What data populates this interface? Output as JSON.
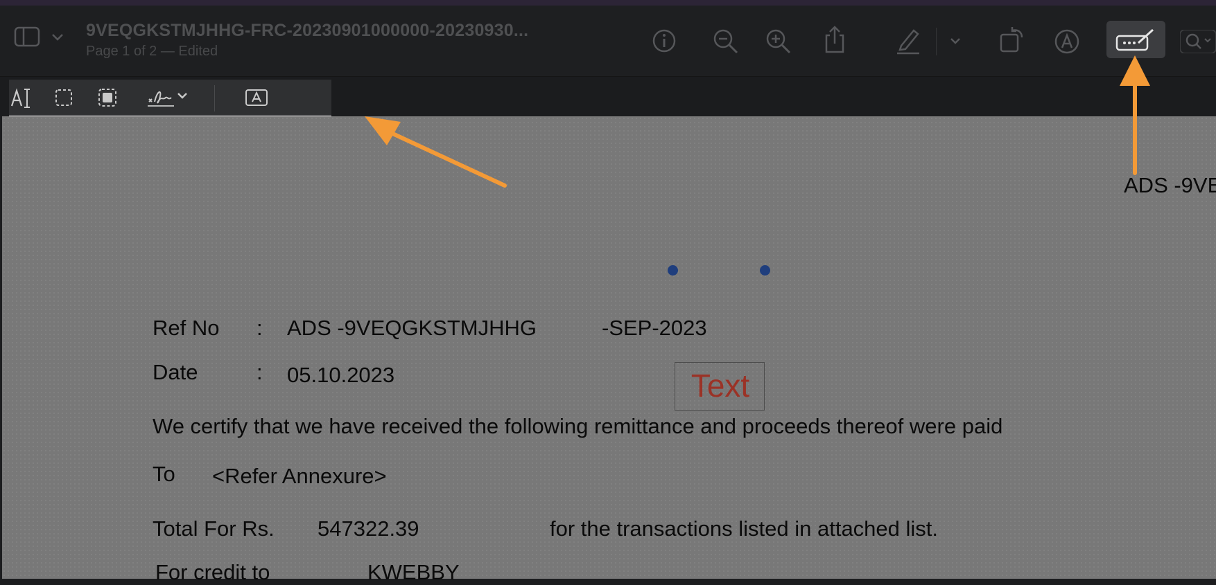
{
  "window": {
    "title": "9VEQGKSTMJHHG-FRC-20230901000000-20230930...",
    "subtitle": "Page 1 of 2 — Edited"
  },
  "toolbar": {
    "icons": [
      "sidebar-icon",
      "chevron-down-icon",
      "info-icon",
      "zoom-out-icon",
      "zoom-in-icon",
      "share-icon",
      "highlight-icon",
      "chevron-down-icon",
      "rotate-icon",
      "annotate-icon",
      "markup-toolbar-icon",
      "search-icon"
    ]
  },
  "markup_toolbar": {
    "tools": [
      "text-selection-icon",
      "rectangular-selection-icon",
      "smart-lasso-icon",
      "signature-icon",
      "text-box-icon"
    ]
  },
  "annotation_box": {
    "text": "Text"
  },
  "document": {
    "side_text": "ADS -9VE",
    "ref_label": "Ref No",
    "colon": ":",
    "ref_value": "ADS -9VEQGKSTMJHHG",
    "ref_suffix": "-SEP-2023",
    "date_label": "Date",
    "date_value": "05.10.2023",
    "certify_line": "We certify that we have received the following remittance and proceeds thereof were paid",
    "to_label": "To",
    "to_value": "<Refer Annexure>",
    "total_label": "Total For Rs.",
    "total_value": "547322.39",
    "total_desc": "for the transactions listed in attached list.",
    "credit_label": "For credit to",
    "credit_value": "KWEBBY"
  },
  "colors": {
    "arrow": "#f39a37",
    "annotation_text": "#9b3226",
    "handle": "#1f3e7d",
    "page": "#787878",
    "toolbar": "#1e1f21"
  }
}
